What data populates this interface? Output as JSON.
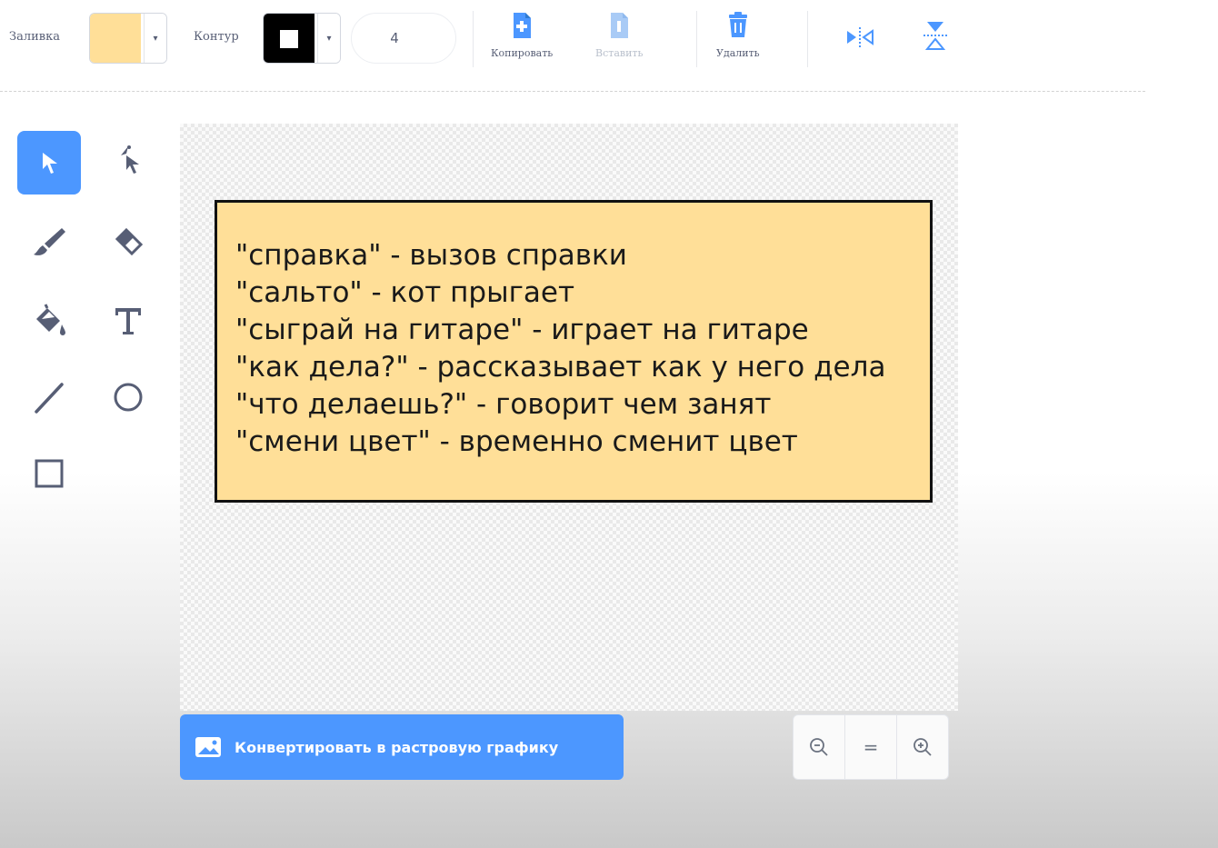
{
  "toolbar": {
    "fill_label": "Заливка",
    "fill_color": "#ffdf98",
    "outline_label": "Контур",
    "outline_color": "#000000",
    "outline_width": "4",
    "copy_label": "Копировать",
    "paste_label": "Вставить",
    "delete_label": "Удалить",
    "flip_horizontal_icon": "flip-horizontal-icon",
    "flip_vertical_icon": "flip-vertical-icon"
  },
  "tools": [
    {
      "name": "select",
      "icon": "arrow-pointer-icon",
      "active": true
    },
    {
      "name": "reshape",
      "icon": "reshape-pointer-icon"
    },
    {
      "name": "brush",
      "icon": "brush-icon"
    },
    {
      "name": "eraser",
      "icon": "eraser-icon"
    },
    {
      "name": "fill",
      "icon": "fill-bucket-icon"
    },
    {
      "name": "text",
      "icon": "text-icon"
    },
    {
      "name": "line",
      "icon": "line-icon"
    },
    {
      "name": "circle",
      "icon": "circle-icon"
    },
    {
      "name": "rectangle",
      "icon": "rectangle-icon"
    }
  ],
  "note": {
    "lines": [
      "\"справка\" - вызов справки",
      "\"сальто\" - кот прыгает",
      "\"сыграй на гитаре\" - играет на гитаре",
      "\"как дела?\" - рассказывает как у него дела",
      "\"что делаешь?\" - говорит чем занят",
      "\"смени цвет\" - временно сменит цвет"
    ]
  },
  "convert_button": "Конвертировать в растровую графику",
  "zoom": {
    "zoom_out_icon": "zoom-out-icon",
    "reset_label": "=",
    "zoom_in_icon": "zoom-in-icon"
  },
  "colors": {
    "accent": "#4c97ff",
    "note_fill": "#ffdf98"
  }
}
